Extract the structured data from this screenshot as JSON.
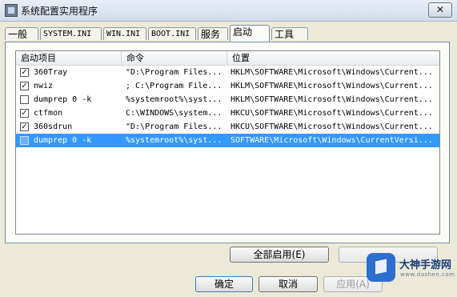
{
  "window": {
    "title": "系统配置实用程序",
    "close_glyph": "✕"
  },
  "tabs": [
    {
      "label": "一般",
      "active": false
    },
    {
      "label": "SYSTEM.INI",
      "active": false
    },
    {
      "label": "WIN.INI",
      "active": false
    },
    {
      "label": "BOOT.INI",
      "active": false
    },
    {
      "label": "服务",
      "active": false
    },
    {
      "label": "启动",
      "active": true
    },
    {
      "label": "工具",
      "active": false
    }
  ],
  "startup_list": {
    "columns": [
      "启动项目",
      "命令",
      "位置"
    ],
    "rows": [
      {
        "checked": true,
        "item": "360Tray",
        "command": "\"D:\\Program Files...",
        "location": "HKLM\\SOFTWARE\\Microsoft\\Windows\\Current...",
        "selected": false
      },
      {
        "checked": true,
        "item": "nwiz",
        "command": "; C:\\Program File...",
        "location": "HKLM\\SOFTWARE\\Microsoft\\Windows\\Current...",
        "selected": false
      },
      {
        "checked": false,
        "item": "dumprep 0 -k",
        "command": "%systemroot%\\syst...",
        "location": "HKLM\\SOFTWARE\\Microsoft\\Windows\\Current...",
        "selected": false
      },
      {
        "checked": true,
        "item": "ctfmon",
        "command": "C:\\WINDOWS\\system...",
        "location": "HKCU\\SOFTWARE\\Microsoft\\Windows\\Current...",
        "selected": false
      },
      {
        "checked": true,
        "item": "360sdrun",
        "command": "\"D:\\Program Files...",
        "location": "HKCU\\SOFTWARE\\Microsoft\\Windows\\Current...",
        "selected": false
      },
      {
        "checked": false,
        "item": "dumprep 0 -k",
        "command": "%systemroot%\\syst...",
        "location": "SOFTWARE\\Microsoft\\Windows\\CurrentVersi...",
        "selected": true
      }
    ]
  },
  "buttons": {
    "enable_all": "全部启用(E)",
    "disable_all": "",
    "ok": "确定",
    "cancel": "取消",
    "apply": "应用(A)"
  },
  "watermark": {
    "brand": "大神手游网",
    "url": "www.dashen.com"
  },
  "colors": {
    "selection": "#3399ff",
    "window_bg": "#ece9d8"
  },
  "icons": {
    "check": "✓",
    "app": "msconfig-icon",
    "watermark_logo": "cube-logo-icon"
  }
}
